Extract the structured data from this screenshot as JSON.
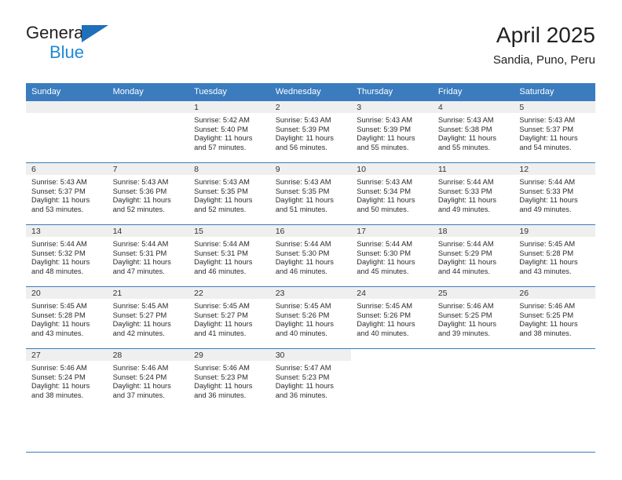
{
  "brand": {
    "name_top": "General",
    "name_bottom": "Blue",
    "triangle_color": "#1e70b8",
    "bottom_color": "#1e8ad6"
  },
  "header": {
    "month_title": "April 2025",
    "location": "Sandia, Puno, Peru"
  },
  "theme": {
    "header_bg": "#3a7cbe",
    "header_text": "#ffffff",
    "daynum_bg": "#efefef",
    "cell_bg": "#ffffff",
    "body_text": "#2b2b2b"
  },
  "weekday_headers": [
    "Sunday",
    "Monday",
    "Tuesday",
    "Wednesday",
    "Thursday",
    "Friday",
    "Saturday"
  ],
  "weeks": [
    [
      {
        "day": "",
        "lines": []
      },
      {
        "day": "",
        "lines": []
      },
      {
        "day": "1",
        "lines": [
          "Sunrise: 5:42 AM",
          "Sunset: 5:40 PM",
          "Daylight: 11 hours",
          "and 57 minutes."
        ]
      },
      {
        "day": "2",
        "lines": [
          "Sunrise: 5:43 AM",
          "Sunset: 5:39 PM",
          "Daylight: 11 hours",
          "and 56 minutes."
        ]
      },
      {
        "day": "3",
        "lines": [
          "Sunrise: 5:43 AM",
          "Sunset: 5:39 PM",
          "Daylight: 11 hours",
          "and 55 minutes."
        ]
      },
      {
        "day": "4",
        "lines": [
          "Sunrise: 5:43 AM",
          "Sunset: 5:38 PM",
          "Daylight: 11 hours",
          "and 55 minutes."
        ]
      },
      {
        "day": "5",
        "lines": [
          "Sunrise: 5:43 AM",
          "Sunset: 5:37 PM",
          "Daylight: 11 hours",
          "and 54 minutes."
        ]
      }
    ],
    [
      {
        "day": "6",
        "lines": [
          "Sunrise: 5:43 AM",
          "Sunset: 5:37 PM",
          "Daylight: 11 hours",
          "and 53 minutes."
        ]
      },
      {
        "day": "7",
        "lines": [
          "Sunrise: 5:43 AM",
          "Sunset: 5:36 PM",
          "Daylight: 11 hours",
          "and 52 minutes."
        ]
      },
      {
        "day": "8",
        "lines": [
          "Sunrise: 5:43 AM",
          "Sunset: 5:35 PM",
          "Daylight: 11 hours",
          "and 52 minutes."
        ]
      },
      {
        "day": "9",
        "lines": [
          "Sunrise: 5:43 AM",
          "Sunset: 5:35 PM",
          "Daylight: 11 hours",
          "and 51 minutes."
        ]
      },
      {
        "day": "10",
        "lines": [
          "Sunrise: 5:43 AM",
          "Sunset: 5:34 PM",
          "Daylight: 11 hours",
          "and 50 minutes."
        ]
      },
      {
        "day": "11",
        "lines": [
          "Sunrise: 5:44 AM",
          "Sunset: 5:33 PM",
          "Daylight: 11 hours",
          "and 49 minutes."
        ]
      },
      {
        "day": "12",
        "lines": [
          "Sunrise: 5:44 AM",
          "Sunset: 5:33 PM",
          "Daylight: 11 hours",
          "and 49 minutes."
        ]
      }
    ],
    [
      {
        "day": "13",
        "lines": [
          "Sunrise: 5:44 AM",
          "Sunset: 5:32 PM",
          "Daylight: 11 hours",
          "and 48 minutes."
        ]
      },
      {
        "day": "14",
        "lines": [
          "Sunrise: 5:44 AM",
          "Sunset: 5:31 PM",
          "Daylight: 11 hours",
          "and 47 minutes."
        ]
      },
      {
        "day": "15",
        "lines": [
          "Sunrise: 5:44 AM",
          "Sunset: 5:31 PM",
          "Daylight: 11 hours",
          "and 46 minutes."
        ]
      },
      {
        "day": "16",
        "lines": [
          "Sunrise: 5:44 AM",
          "Sunset: 5:30 PM",
          "Daylight: 11 hours",
          "and 46 minutes."
        ]
      },
      {
        "day": "17",
        "lines": [
          "Sunrise: 5:44 AM",
          "Sunset: 5:30 PM",
          "Daylight: 11 hours",
          "and 45 minutes."
        ]
      },
      {
        "day": "18",
        "lines": [
          "Sunrise: 5:44 AM",
          "Sunset: 5:29 PM",
          "Daylight: 11 hours",
          "and 44 minutes."
        ]
      },
      {
        "day": "19",
        "lines": [
          "Sunrise: 5:45 AM",
          "Sunset: 5:28 PM",
          "Daylight: 11 hours",
          "and 43 minutes."
        ]
      }
    ],
    [
      {
        "day": "20",
        "lines": [
          "Sunrise: 5:45 AM",
          "Sunset: 5:28 PM",
          "Daylight: 11 hours",
          "and 43 minutes."
        ]
      },
      {
        "day": "21",
        "lines": [
          "Sunrise: 5:45 AM",
          "Sunset: 5:27 PM",
          "Daylight: 11 hours",
          "and 42 minutes."
        ]
      },
      {
        "day": "22",
        "lines": [
          "Sunrise: 5:45 AM",
          "Sunset: 5:27 PM",
          "Daylight: 11 hours",
          "and 41 minutes."
        ]
      },
      {
        "day": "23",
        "lines": [
          "Sunrise: 5:45 AM",
          "Sunset: 5:26 PM",
          "Daylight: 11 hours",
          "and 40 minutes."
        ]
      },
      {
        "day": "24",
        "lines": [
          "Sunrise: 5:45 AM",
          "Sunset: 5:26 PM",
          "Daylight: 11 hours",
          "and 40 minutes."
        ]
      },
      {
        "day": "25",
        "lines": [
          "Sunrise: 5:46 AM",
          "Sunset: 5:25 PM",
          "Daylight: 11 hours",
          "and 39 minutes."
        ]
      },
      {
        "day": "26",
        "lines": [
          "Sunrise: 5:46 AM",
          "Sunset: 5:25 PM",
          "Daylight: 11 hours",
          "and 38 minutes."
        ]
      }
    ],
    [
      {
        "day": "27",
        "lines": [
          "Sunrise: 5:46 AM",
          "Sunset: 5:24 PM",
          "Daylight: 11 hours",
          "and 38 minutes."
        ]
      },
      {
        "day": "28",
        "lines": [
          "Sunrise: 5:46 AM",
          "Sunset: 5:24 PM",
          "Daylight: 11 hours",
          "and 37 minutes."
        ]
      },
      {
        "day": "29",
        "lines": [
          "Sunrise: 5:46 AM",
          "Sunset: 5:23 PM",
          "Daylight: 11 hours",
          "and 36 minutes."
        ]
      },
      {
        "day": "30",
        "lines": [
          "Sunrise: 5:47 AM",
          "Sunset: 5:23 PM",
          "Daylight: 11 hours",
          "and 36 minutes."
        ]
      },
      {
        "day": "",
        "lines": []
      },
      {
        "day": "",
        "lines": []
      },
      {
        "day": "",
        "lines": []
      }
    ]
  ]
}
